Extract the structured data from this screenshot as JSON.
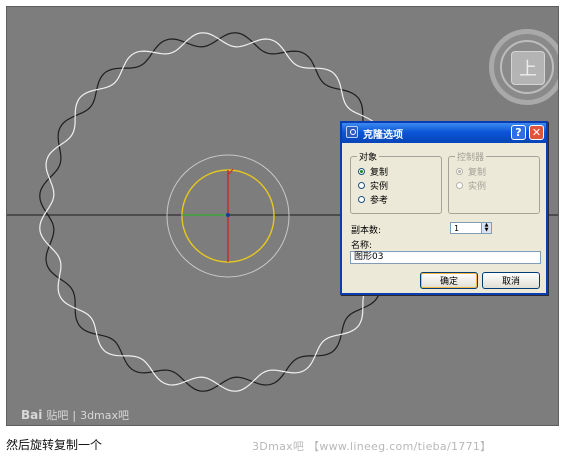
{
  "viewport": {
    "viewcube_label": "上"
  },
  "dialog": {
    "title": "克隆选项",
    "object_group": {
      "legend": "对象",
      "options": [
        {
          "label": "复制",
          "checked": true
        },
        {
          "label": "实例",
          "checked": false
        },
        {
          "label": "参考",
          "checked": false
        }
      ]
    },
    "controller_group": {
      "legend": "控制器",
      "options": [
        {
          "label": "复制",
          "checked": true
        },
        {
          "label": "实例",
          "checked": false
        }
      ]
    },
    "copies_label": "副本数:",
    "copies_value": "1",
    "name_label": "名称:",
    "name_value": "图形03",
    "ok_label": "确定",
    "cancel_label": "取消"
  },
  "watermark": {
    "brand": "Bai",
    "brand2": "贴吧",
    "separator": "|",
    "forum": "3dmax吧"
  },
  "caption": "然后旋转复制一个",
  "source": "3Dmax吧 【www.lineeg.com/tieba/1771】"
}
